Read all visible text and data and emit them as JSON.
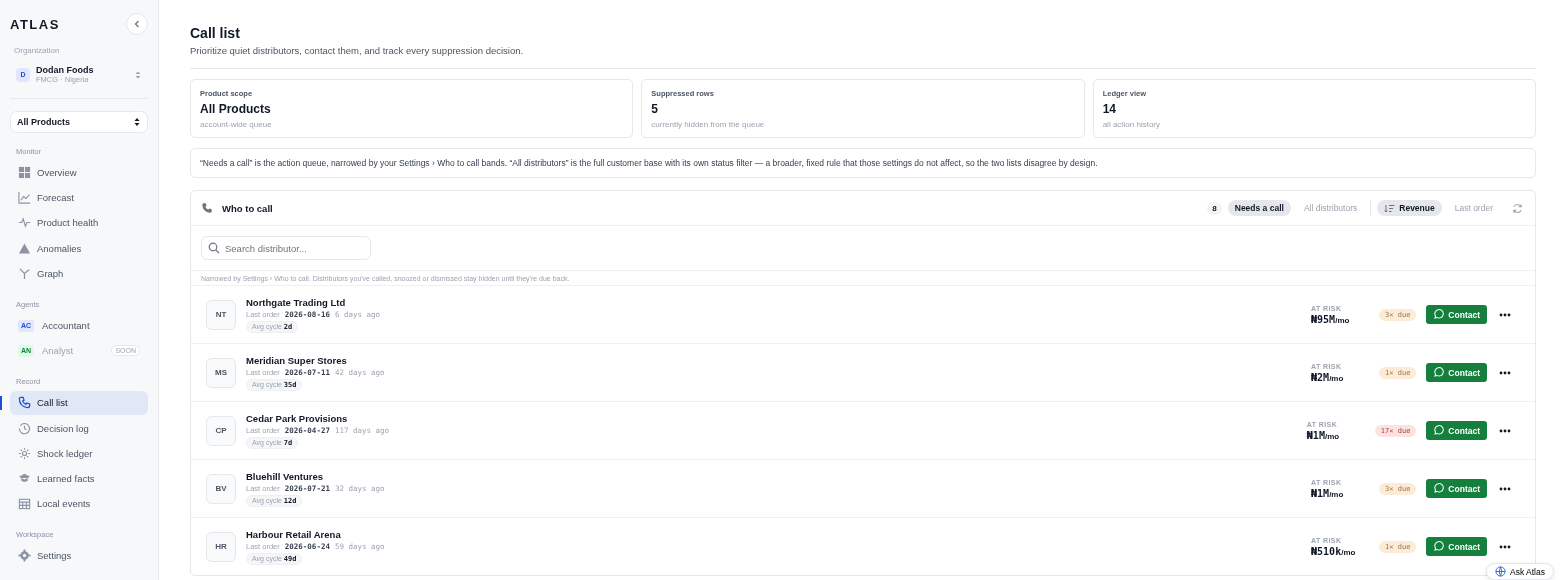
{
  "brand": "ATLAS",
  "organization": {
    "label": "Organization",
    "avatar": "D",
    "name": "Dodan Foods",
    "subtitle": "FMCG · Nigeria"
  },
  "product_select": {
    "value": "All Products"
  },
  "nav_sections": [
    {
      "label": "Monitor",
      "items": [
        {
          "label": "Overview",
          "selected": false,
          "disabled": false
        },
        {
          "label": "Forecast",
          "selected": false,
          "disabled": false
        },
        {
          "label": "Product health",
          "selected": false,
          "disabled": false
        },
        {
          "label": "Anomalies",
          "selected": false,
          "disabled": false
        },
        {
          "label": "Graph",
          "selected": false,
          "disabled": false
        }
      ]
    },
    {
      "label": "Agents",
      "items": [
        {
          "label": "Accountant",
          "avatar": "AC",
          "selected": false,
          "disabled": false
        },
        {
          "label": "Analyst",
          "avatar": "AN",
          "badge": "SOON",
          "selected": false,
          "disabled": true
        }
      ]
    },
    {
      "label": "Record",
      "items": [
        {
          "label": "Call list",
          "selected": true,
          "disabled": false
        },
        {
          "label": "Decision log",
          "selected": false,
          "disabled": false
        },
        {
          "label": "Shock ledger",
          "selected": false,
          "disabled": false
        },
        {
          "label": "Learned facts",
          "selected": false,
          "disabled": false
        },
        {
          "label": "Local events",
          "selected": false,
          "disabled": false
        }
      ]
    },
    {
      "label": "Workspace",
      "items": [
        {
          "label": "Settings",
          "selected": false,
          "disabled": false
        }
      ]
    }
  ],
  "page": {
    "title": "Call list",
    "subtitle": "Prioritize quiet distributors, contact them, and track every suppression decision."
  },
  "stats": [
    {
      "label": "Product scope",
      "value": "All Products",
      "note": "account-wide queue"
    },
    {
      "label": "Suppressed rows",
      "value": "5",
      "note": "currently hidden from the queue"
    },
    {
      "label": "Ledger view",
      "value": "14",
      "note": "all action history"
    }
  ],
  "info_note": "“Needs a call” is the action queue, narrowed by your Settings › Who to call bands. “All distributors” is the full customer base with its own status filter — a broader, fixed rule that those settings do not affect, so the two lists disagree by design.",
  "panel": {
    "title": "Who to call",
    "count": "8",
    "filters": [
      {
        "label": "Needs a call",
        "selected": true
      },
      {
        "label": "All distributors",
        "selected": false
      }
    ],
    "sorts": [
      {
        "label": "Revenue",
        "selected": true
      },
      {
        "label": "Last order",
        "selected": false
      }
    ],
    "search": {
      "placeholder": "Search distributor..."
    },
    "note": "Narrowed by Settings › Who to call. Distributors you've called, snoozed or dismissed stay hidden until they're due back.",
    "rows": [
      {
        "initials": "NT",
        "name": "Northgate Trading Ltd",
        "last_order_label": "Last order",
        "date": "2026-08-16",
        "ago": "6 days ago",
        "cycle_label": "Avg cycle",
        "cycle": "2d",
        "risk_label": "AT RISK",
        "amount": "₦95M",
        "unit": "/mo",
        "due": "3× due",
        "color": "#fcebd6",
        "action": "Contact"
      },
      {
        "initials": "MS",
        "name": "Meridian Super Stores",
        "last_order_label": "Last order",
        "date": "2026-07-11",
        "ago": "42 days ago",
        "cycle_label": "Avg cycle",
        "cycle": "35d",
        "risk_label": "AT RISK",
        "amount": "₦2M",
        "unit": "/mo",
        "due": "1× due",
        "color": "#fcebd6",
        "action": "Contact"
      },
      {
        "initials": "CP",
        "name": "Cedar Park Provisions",
        "last_order_label": "Last order",
        "date": "2026-04-27",
        "ago": "117 days ago",
        "cycle_label": "Avg cycle",
        "cycle": "7d",
        "risk_label": "AT RISK",
        "amount": "₦1M",
        "unit": "/mo",
        "due": "17× due",
        "color": "#fde2e2",
        "action": "Contact"
      },
      {
        "initials": "BV",
        "name": "Bluehill Ventures",
        "last_order_label": "Last order",
        "date": "2026-07-21",
        "ago": "32 days ago",
        "cycle_label": "Avg cycle",
        "cycle": "12d",
        "risk_label": "AT RISK",
        "amount": "₦1M",
        "unit": "/mo",
        "due": "3× due",
        "color": "#fcebd6",
        "action": "Contact"
      },
      {
        "initials": "HR",
        "name": "Harbour Retail Arena",
        "last_order_label": "Last order",
        "date": "2026-06-24",
        "ago": "59 days ago",
        "cycle_label": "Avg cycle",
        "cycle": "49d",
        "risk_label": "AT RISK",
        "amount": "₦510k",
        "unit": "/mo",
        "due": "1× due",
        "color": "#fcebd6",
        "action": "Contact"
      }
    ]
  },
  "assistant_button": "Ask Atlas"
}
